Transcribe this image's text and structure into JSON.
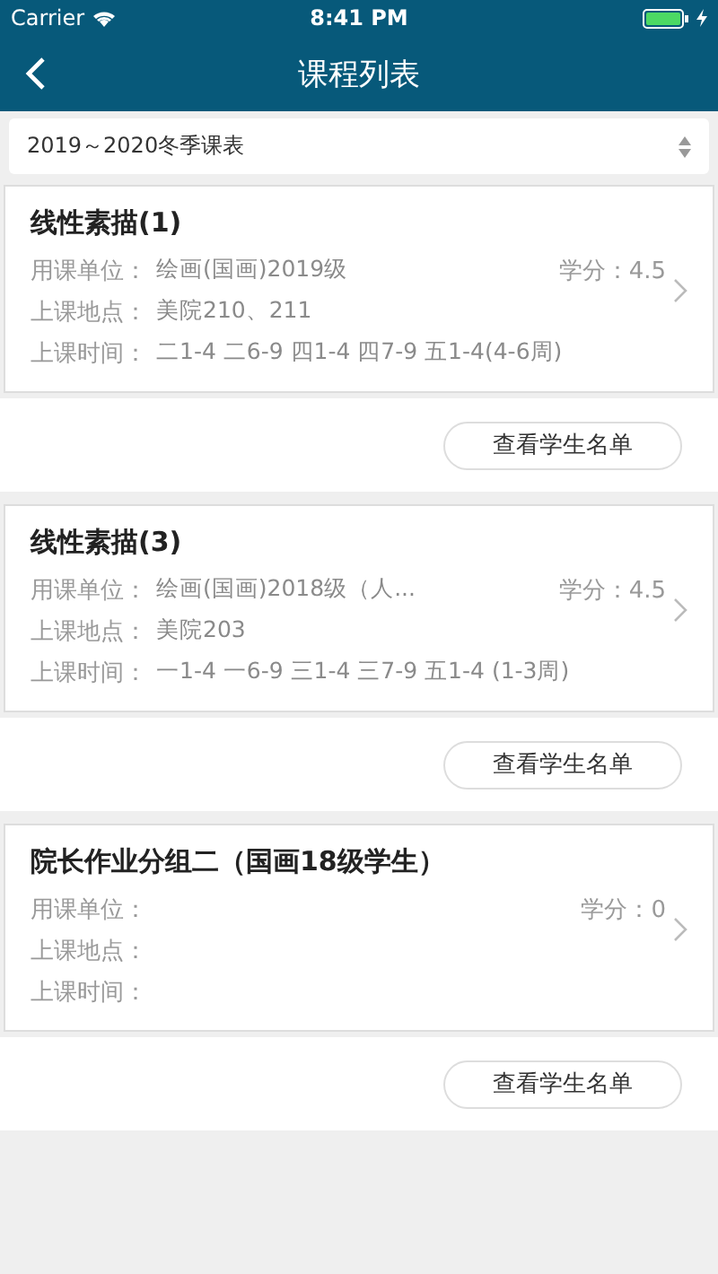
{
  "status_bar": {
    "carrier": "Carrier",
    "time": "8:41 PM"
  },
  "nav": {
    "title": "课程列表"
  },
  "term_select": {
    "value": "2019～2020冬季课表"
  },
  "courses": [
    {
      "title": "线性素描(1)",
      "unit_label": "用课单位：",
      "unit": "绘画(国画)2019级",
      "credit_label": "学分：",
      "credit": "4.5",
      "location_label": "上课地点：",
      "location": "美院210、211",
      "time_label": "上课时间：",
      "time": "二1-4 二6-9 四1-4 四7-9 五1-4(4-6周)",
      "button": "查看学生名单"
    },
    {
      "title": "线性素描(3)",
      "unit_label": "用课单位：",
      "unit": "绘画(国画)2018级（人...",
      "credit_label": "学分：",
      "credit": "4.5",
      "location_label": "上课地点：",
      "location": "美院203",
      "time_label": "上课时间：",
      "time": "一1-4 一6-9 三1-4 三7-9 五1-4 (1-3周)",
      "button": "查看学生名单"
    },
    {
      "title": "院长作业分组二（国画18级学生）",
      "unit_label": "用课单位：",
      "credit_label": "学分：",
      "credit": "0",
      "location_label": "上课地点：",
      "time_label": "上课时间：",
      "button": "查看学生名单"
    }
  ]
}
